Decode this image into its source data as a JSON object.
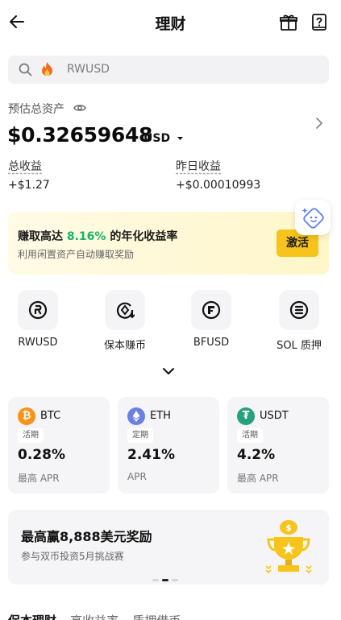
{
  "header": {
    "title": "理财",
    "back_icon": "arrow-left-icon",
    "gift_icon": "gift-icon",
    "help_icon": "question-book-icon"
  },
  "search": {
    "icon": "search-icon",
    "hot_icon": "fire-icon",
    "placeholder": "RWUSD"
  },
  "assets": {
    "label": "预估总资产",
    "eye_icon": "eye-icon",
    "balance": "$0.32659648",
    "currency": "USD",
    "total_profit_label": "总收益",
    "total_profit_value": "+$1.27",
    "yesterday_profit_label": "昨日收益",
    "yesterday_profit_value": "+$0.00010993"
  },
  "promo": {
    "title_prefix": "赚取高达",
    "title_highlight": "8.16%",
    "title_suffix": "的年化收益率",
    "subtitle": "利用闲置资产自动赚取奖励",
    "button": "激活",
    "highlight_color": "#17b26a",
    "button_color": "#f6c41a"
  },
  "quick_actions": [
    {
      "label": "RWUSD",
      "icon": "rwusd-icon"
    },
    {
      "label": "保本赚币",
      "icon": "principal-protected-icon"
    },
    {
      "label": "BFUSD",
      "icon": "bfusd-icon"
    },
    {
      "label": "SOL 质押",
      "icon": "sol-staking-icon"
    }
  ],
  "coins": [
    {
      "name": "BTC",
      "tag": "活期",
      "rate": "0.28%",
      "rate_label": "最高 APR",
      "color": "#f7931a"
    },
    {
      "name": "ETH",
      "tag": "定期",
      "rate": "2.41%",
      "rate_label": "APR",
      "color": "#6c7fe3"
    },
    {
      "name": "USDT",
      "tag": "活期",
      "rate": "4.2%",
      "rate_label": "最高 APR",
      "color": "#26a17b"
    }
  ],
  "banner": {
    "title": "最高赢8,888美元奖励",
    "subtitle": "参与双币投资5月挑战赛",
    "icon": "trophy-icon"
  },
  "bottom_tabs": [
    "保本理财",
    "高收益率",
    "质押借币"
  ]
}
